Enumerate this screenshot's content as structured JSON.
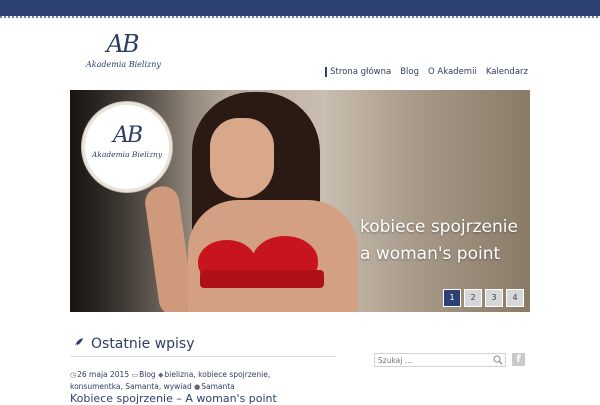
{
  "brand": {
    "monogram": "AB",
    "name": "Akademia Bielizny"
  },
  "nav": {
    "items": [
      {
        "label": "Strona główna",
        "active": true
      },
      {
        "label": "Blog"
      },
      {
        "label": "O Akademii"
      },
      {
        "label": "Kalendarz"
      }
    ]
  },
  "hero": {
    "badge_monogram": "AB",
    "badge_name": "Akademia Bielizny",
    "caption_line1": "kobiece spojrzenie",
    "caption_line2": "a woman's point",
    "pager": [
      "1",
      "2",
      "3",
      "4"
    ],
    "pager_active": "1"
  },
  "section": {
    "title": "Ostatnie wpisy",
    "icon": "quill-icon"
  },
  "post": {
    "date": "26 maja 2015",
    "category": "Blog",
    "tags": "bielizna, kobiece spojrzenie,",
    "tags_line2": "konsumentka, Samanta, wywiad",
    "author": "Samanta",
    "title": "Kobiece spojrzenie – A woman's point"
  },
  "sidebar": {
    "search_placeholder": "Szukaj ...",
    "facebook_label": "f"
  },
  "colors": {
    "accent": "#2d4272",
    "text": "#2c3e64",
    "bra": "#c8141c"
  }
}
